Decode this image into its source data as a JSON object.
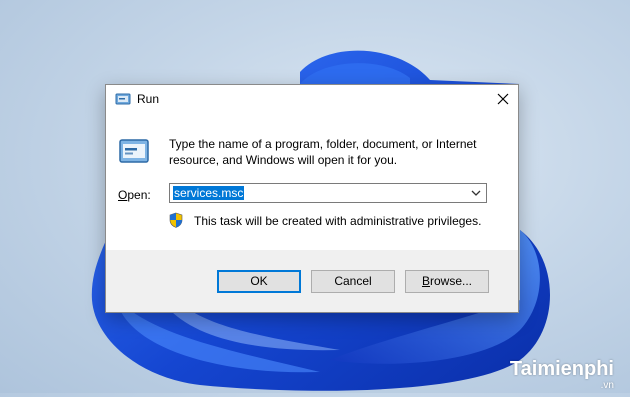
{
  "dialog": {
    "title": "Run",
    "close_label": "✕",
    "description": "Type the name of a program, folder, document, or Internet resource, and Windows will open it for you.",
    "open_label_prefix": "O",
    "open_label_rest": "pen:",
    "command_value": "services.msc",
    "privilege_note": "This task will be created with administrative privileges.",
    "buttons": {
      "ok": "OK",
      "cancel": "Cancel",
      "browse_underlined": "B",
      "browse_rest": "rowse..."
    }
  },
  "watermark": {
    "brand": "Taimienphi",
    "domain": ".vn"
  },
  "icons": {
    "app": "run-app-icon",
    "dialog_large": "run-large-icon",
    "dropdown": "chevron-down-icon",
    "shield": "uac-shield-icon",
    "close": "close-icon"
  },
  "colors": {
    "accent": "#0078d7",
    "wallpaper_bloom": "#1a4fd6",
    "footer": "#f0f0f0"
  }
}
